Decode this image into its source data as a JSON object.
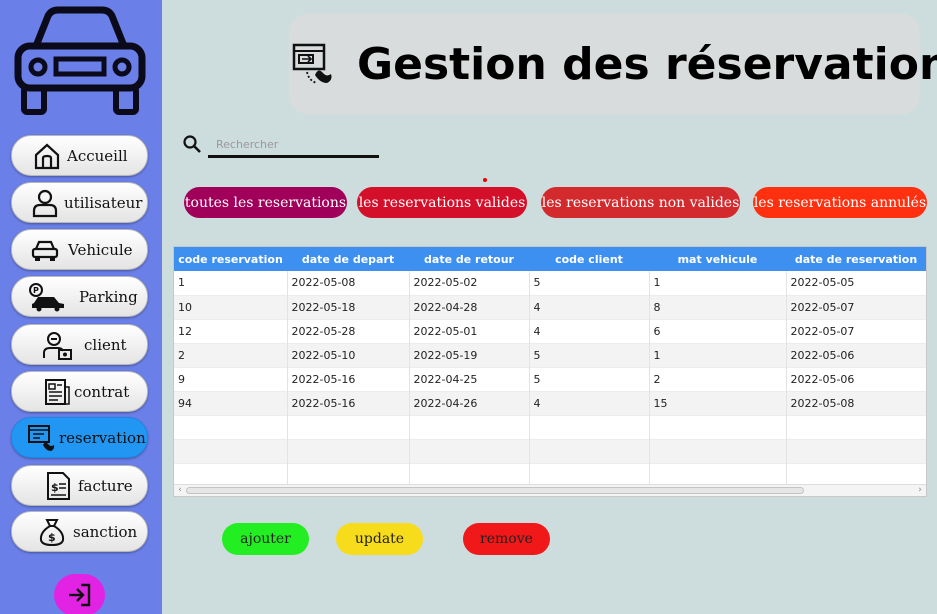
{
  "sidebar": {
    "items": [
      {
        "label": "Accueill",
        "icon": "home-icon"
      },
      {
        "label": "utilisateur",
        "icon": "user-icon"
      },
      {
        "label": "Vehicule",
        "icon": "car-icon"
      },
      {
        "label": "Parking",
        "icon": "parking-icon"
      },
      {
        "label": "client",
        "icon": "client-icon"
      },
      {
        "label": "contrat",
        "icon": "contract-icon"
      },
      {
        "label": "reservation",
        "icon": "reservation-icon",
        "active": true
      },
      {
        "label": "facture",
        "icon": "invoice-icon"
      },
      {
        "label": "sanction",
        "icon": "money-bag-icon"
      }
    ],
    "logout_icon": "logout-icon"
  },
  "header": {
    "title": "Gestion des réservations",
    "icon": "reservation-icon"
  },
  "search": {
    "placeholder": "Rechercher",
    "value": ""
  },
  "filters": [
    {
      "label": "toutes les reservations",
      "color": "#a0005a"
    },
    {
      "label": "les reservations valides",
      "color": "#d40f2a"
    },
    {
      "label": "les reservations non valides",
      "color": "#d32a2e"
    },
    {
      "label": "les reservations annulés",
      "color": "#ff3010"
    }
  ],
  "table": {
    "columns": [
      "code reservation",
      "date de depart",
      "date de retour",
      "code client",
      "mat vehicule",
      "date de reservation"
    ],
    "rows": [
      [
        "1",
        "2022-05-08",
        "2022-05-02",
        "5",
        "1",
        "2022-05-05"
      ],
      [
        "10",
        "2022-05-18",
        "2022-04-28",
        "4",
        "8",
        "2022-05-07"
      ],
      [
        "12",
        "2022-05-28",
        "2022-05-01",
        "4",
        "6",
        "2022-05-07"
      ],
      [
        "2",
        "2022-05-10",
        "2022-05-19",
        "5",
        "1",
        "2022-05-06"
      ],
      [
        "9",
        "2022-05-16",
        "2022-04-25",
        "5",
        "2",
        "2022-05-06"
      ],
      [
        "94",
        "2022-05-16",
        "2022-04-26",
        "4",
        "15",
        "2022-05-08"
      ],
      [
        "",
        "",
        "",
        "",
        "",
        ""
      ],
      [
        "",
        "",
        "",
        "",
        "",
        ""
      ],
      [
        "",
        "",
        "",
        "",
        "",
        ""
      ]
    ]
  },
  "actions": {
    "add_label": "ajouter",
    "update_label": "update",
    "remove_label": "remove",
    "add_color": "#22ee22",
    "update_color": "#f7dc1c",
    "remove_color": "#f01818"
  },
  "colors": {
    "sidebar_bg": "#6a7fe8",
    "active_nav": "#2196f3",
    "table_header": "#3d8ff0",
    "logout_bg": "#e323e3"
  }
}
